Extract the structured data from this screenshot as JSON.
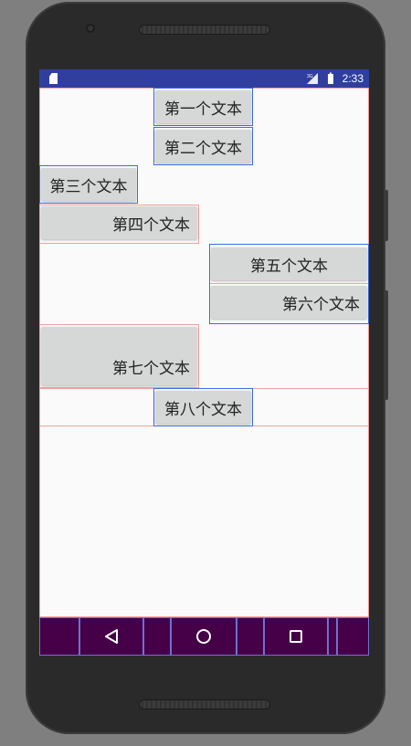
{
  "status_bar": {
    "time": "2:33",
    "network_label": "3G",
    "icons": [
      "sd-card-icon",
      "signal-icon",
      "battery-icon"
    ]
  },
  "text_views": [
    {
      "label": "第一个文本",
      "alignment": "center"
    },
    {
      "label": "第二个文本",
      "alignment": "center"
    },
    {
      "label": "第三个文本",
      "alignment": "center"
    },
    {
      "label": "第四个文本",
      "alignment": "right"
    },
    {
      "label": "第五个文本",
      "alignment": "center"
    },
    {
      "label": "第六个文本",
      "alignment": "right"
    },
    {
      "label": "第七个文本",
      "alignment": "bottom-right"
    },
    {
      "label": "第八个文本",
      "alignment": "center"
    }
  ],
  "nav_bar": {
    "icons": [
      "back-icon",
      "home-icon",
      "recents-icon"
    ]
  },
  "colors": {
    "status_bar": "#303f9f",
    "nav_bar": "#450047",
    "button_bg": "#d6d7d7",
    "layout_bounds": "#3d6de4",
    "margin_bounds": "#f3a0a0"
  }
}
